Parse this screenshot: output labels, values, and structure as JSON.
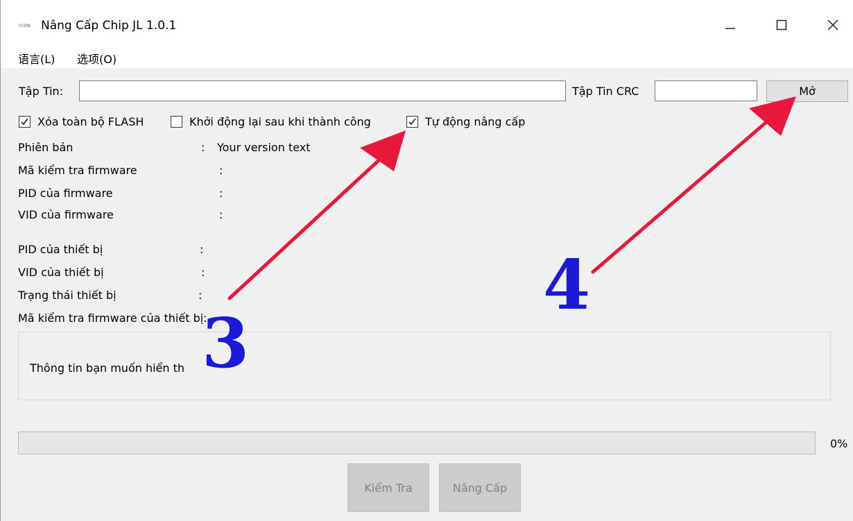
{
  "window": {
    "icon_text": "ICON",
    "title": "Nâng Cấp Chip JL 1.0.1",
    "minimize": "—",
    "maximize": "☐",
    "close": "✕"
  },
  "menu": {
    "items": [
      "语言(L)",
      "选项(O)"
    ]
  },
  "file": {
    "label": "Tập Tin:",
    "value": "",
    "crc_label": "Tập Tin CRC",
    "crc_value": "",
    "open_button": "Mở"
  },
  "options": [
    {
      "label": "Xóa toàn bộ FLASH",
      "checked": true
    },
    {
      "label": "Khởi động lại sau khi thành công",
      "checked": false
    },
    {
      "label": "Tự động nâng cấp",
      "checked": true
    }
  ],
  "info": {
    "version_label": "Phiên bản",
    "version_sep": ":",
    "version_value": "Your version text",
    "checksum_label": "Mã kiểm tra firmware",
    "checksum_sep": ":",
    "pid_fw_label": "PID của firmware",
    "pid_fw_sep": ":",
    "vid_fw_label": "VID của firmware",
    "vid_fw_sep": ":",
    "pid_dev_label": "PID của thiết bị",
    "pid_dev_sep": ":",
    "vid_dev_label": "VID của thiết bị",
    "vid_dev_sep": ":",
    "status_label": "Trạng thái thiết bị",
    "status_sep": ":",
    "dev_checksum_label": "Mã kiểm tra firmware của thiết bị:"
  },
  "message": {
    "text": "Thông tin bạn muốn hiển th"
  },
  "progress": {
    "value": 0,
    "text": "0%"
  },
  "actions": {
    "check": "Kiểm Tra",
    "upgrade": "Nâng Cấp"
  },
  "annotations": {
    "step3": "3",
    "step4": "4",
    "arrow_color": "#e8173c",
    "number_color": "#1a1ad8"
  }
}
